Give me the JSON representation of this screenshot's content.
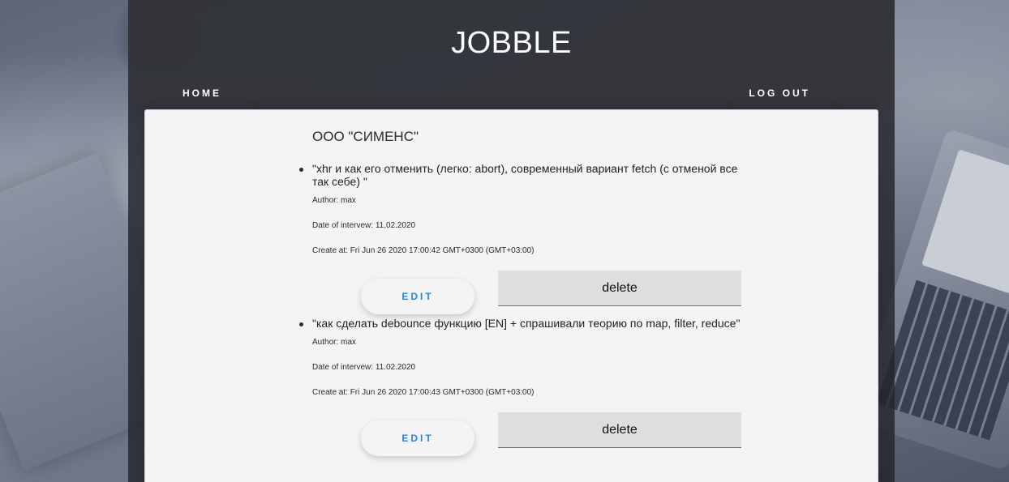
{
  "header": {
    "brand": "JOBBLE",
    "nav": {
      "home": "HOME",
      "logout": "LOG OUT"
    }
  },
  "company": {
    "name": "ООО \"СИМЕНС\""
  },
  "questions": [
    {
      "text": "\"xhr и как его отменить (легко: abort), современный вариант fetch (с отменой все так себе) \"",
      "author": "Author: max",
      "interview_date": "Date of intervew: 11.02.2020",
      "created": "Create at: Fri Jun 26 2020 17:00:42 GMT+0300 (GMT+03:00)",
      "edit_label": "EDIT",
      "delete_label": "delete"
    },
    {
      "text": "\"как сделать debounce функцию [EN] + спрашивали теорию по map, filter, reduce\"",
      "author": "Author: max",
      "interview_date": "Date of intervew: 11.02.2020",
      "created": "Create at: Fri Jun 26 2020 17:00:43 GMT+0300 (GMT+03:00)",
      "edit_label": "EDIT",
      "delete_label": "delete"
    }
  ],
  "colors": {
    "accent": "#1e88e5",
    "header_bg": "#34363c",
    "card_bg": "#f4f4f4",
    "delete_bg": "#dedede"
  }
}
